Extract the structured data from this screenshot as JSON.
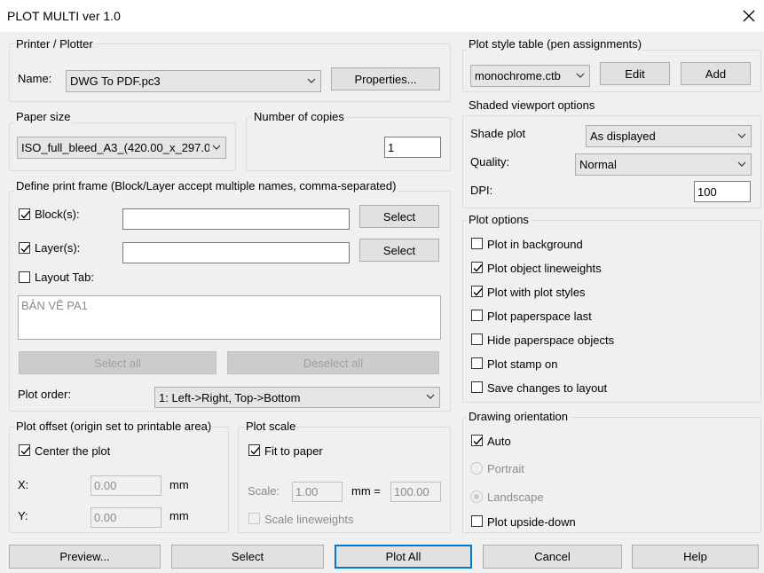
{
  "window": {
    "title": "PLOT MULTI ver 1.0"
  },
  "printer": {
    "group_label": "Printer / Plotter",
    "name_label": "Name:",
    "name_value": "DWG To PDF.pc3",
    "properties_button": "Properties..."
  },
  "paper": {
    "group_label": "Paper size",
    "value": "ISO_full_bleed_A3_(420.00_x_297.0"
  },
  "copies": {
    "group_label": "Number of copies",
    "value": "1"
  },
  "print_frame": {
    "group_label": "Define print frame (Block/Layer accept multiple names, comma-separated)",
    "block_label": "Block(s):",
    "block_checked": true,
    "block_value": "",
    "block_select": "Select",
    "layer_label": "Layer(s):",
    "layer_checked": true,
    "layer_value": "",
    "layer_select": "Select",
    "layout_label": "Layout Tab:",
    "layout_checked": false,
    "layout_items": [
      "BẢN VẼ PA1"
    ],
    "select_all": "Select all",
    "deselect_all": "Deselect all",
    "plot_order_label": "Plot order:",
    "plot_order_value": "1: Left->Right, Top->Bottom"
  },
  "offset": {
    "group_label": "Plot offset (origin set to printable area)",
    "center_label": "Center the plot",
    "center_checked": true,
    "x_label": "X:",
    "x_value": "0.00",
    "y_label": "Y:",
    "y_value": "0.00",
    "unit": "mm"
  },
  "scale": {
    "group_label": "Plot scale",
    "fit_label": "Fit to paper",
    "fit_checked": true,
    "scale_label": "Scale:",
    "scale_value": "1.00",
    "mm_eq": "mm =",
    "units_value": "100.00",
    "lineweights_label": "Scale lineweights",
    "lineweights_checked": false
  },
  "pen": {
    "group_label": "Plot style table (pen assignments)",
    "value": "monochrome.ctb",
    "edit_button": "Edit",
    "add_button": "Add"
  },
  "shaded": {
    "group_label": "Shaded viewport options",
    "shade_label": "Shade plot",
    "shade_value": "As displayed",
    "quality_label": "Quality:",
    "quality_value": "Normal",
    "dpi_label": "DPI:",
    "dpi_value": "100"
  },
  "plot_options": {
    "group_label": "Plot options",
    "items": [
      {
        "label": "Plot in background",
        "checked": false
      },
      {
        "label": "Plot object lineweights",
        "checked": true
      },
      {
        "label": "Plot with plot styles",
        "checked": true
      },
      {
        "label": "Plot paperspace last",
        "checked": false
      },
      {
        "label": "Hide paperspace objects",
        "checked": false
      },
      {
        "label": "Plot stamp on",
        "checked": false
      },
      {
        "label": "Save changes to layout",
        "checked": false
      }
    ]
  },
  "orientation": {
    "group_label": "Drawing orientation",
    "auto_label": "Auto",
    "auto_checked": true,
    "portrait_label": "Portrait",
    "landscape_label": "Landscape",
    "landscape_selected": true,
    "upside_label": "Plot upside-down",
    "upside_checked": false
  },
  "footer": {
    "preview": "Preview...",
    "select": "Select",
    "plot_all": "Plot All",
    "cancel": "Cancel",
    "help": "Help"
  }
}
